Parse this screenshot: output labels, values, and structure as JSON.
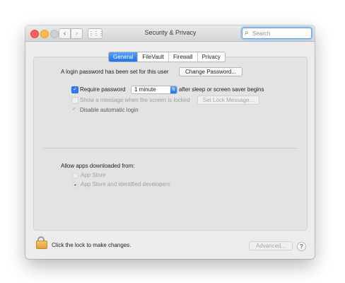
{
  "window": {
    "title": "Security & Privacy",
    "back_glyph": "‹",
    "forward_glyph": "›",
    "grid_glyph": "⋮⋮⋮",
    "search": {
      "placeholder": "Search",
      "value": ""
    }
  },
  "tabs": [
    {
      "label": "General",
      "active": true
    },
    {
      "label": "FileVault",
      "active": false
    },
    {
      "label": "Firewall",
      "active": false
    },
    {
      "label": "Privacy",
      "active": false
    }
  ],
  "general": {
    "login_password_text": "A login password has been set for this user",
    "change_password_label": "Change Password...",
    "require_password": {
      "label": "Require password",
      "checked": true,
      "select_value": "1 minute",
      "suffix": "after sleep or screen saver begins"
    },
    "show_message": {
      "label": "Show a message when the screen is locked",
      "checked": false,
      "enabled": false,
      "button_label": "Set Lock Message..."
    },
    "disable_auto_login": {
      "label": "Disable automatic login",
      "checked": true,
      "enabled": false
    },
    "allow_apps": {
      "heading": "Allow apps downloaded from:",
      "options": [
        {
          "label": "App Store",
          "selected": false
        },
        {
          "label": "App Store and identified developers",
          "selected": true
        }
      ]
    }
  },
  "footer": {
    "lock_text": "Click the lock to make changes.",
    "advanced_label": "Advanced...",
    "help_label": "?"
  },
  "colors": {
    "accent": "#1c74ee",
    "window_bg": "#ececec",
    "panel_bg": "#e3e3e3",
    "lock_gold": "#e0a13b"
  }
}
